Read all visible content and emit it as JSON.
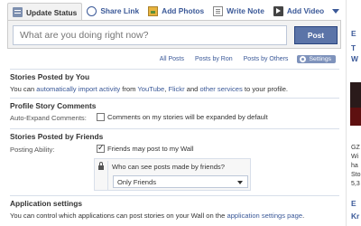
{
  "publisher": {
    "tabs": [
      {
        "label": "Update Status",
        "icon": "status-icon"
      },
      {
        "label": "Share Link",
        "icon": "link-icon"
      },
      {
        "label": "Add Photos",
        "icon": "photo-icon"
      },
      {
        "label": "Write Note",
        "icon": "note-icon"
      },
      {
        "label": "Add Video",
        "icon": "video-icon"
      }
    ],
    "placeholder": "What are you doing right now?",
    "share_label": "Post"
  },
  "filters": {
    "all_posts": "All Posts",
    "posts_by_ron": "Posts by Ron",
    "posts_by_others": "Posts by Others",
    "settings": "Settings"
  },
  "stories_posted_by_you": {
    "heading": "Stories Posted by You",
    "text_1": "You can ",
    "link_import": "automatically import activity",
    "text_2": " from ",
    "link_youtube": "YouTube",
    "text_3": ", ",
    "link_flickr": "Flickr",
    "text_4": " and ",
    "link_other": "other services",
    "text_5": " to your profile."
  },
  "profile_story_comments": {
    "heading": "Profile Story Comments",
    "label": "Auto-Expand Comments:",
    "checkbox_label": "Comments on my stories will be expanded by default",
    "checked": false
  },
  "stories_posted_by_friends": {
    "heading": "Stories Posted by Friends",
    "label": "Posting Ability:",
    "checkbox_label": "Friends may post to my Wall",
    "checked": true,
    "privacy_question": "Who can see posts made by friends?",
    "privacy_value": "Only Friends"
  },
  "application_settings": {
    "heading": "Application settings",
    "text_1": "You can control which applications can post stories on your Wall on the ",
    "link": "application settings page",
    "text_2": "."
  },
  "right_column": {
    "frag_1": "E",
    "frag_2": "T",
    "frag_3": "W",
    "frag_4": "GZ",
    "frag_5": "Wi",
    "frag_6": "ha",
    "frag_7": "Sto",
    "frag_8": "5,3",
    "frag_9": "E",
    "frag_10": "Kr"
  },
  "colors": {
    "link": "#3b5998",
    "button": "#5b74a8",
    "divider": "#d8dfea"
  }
}
